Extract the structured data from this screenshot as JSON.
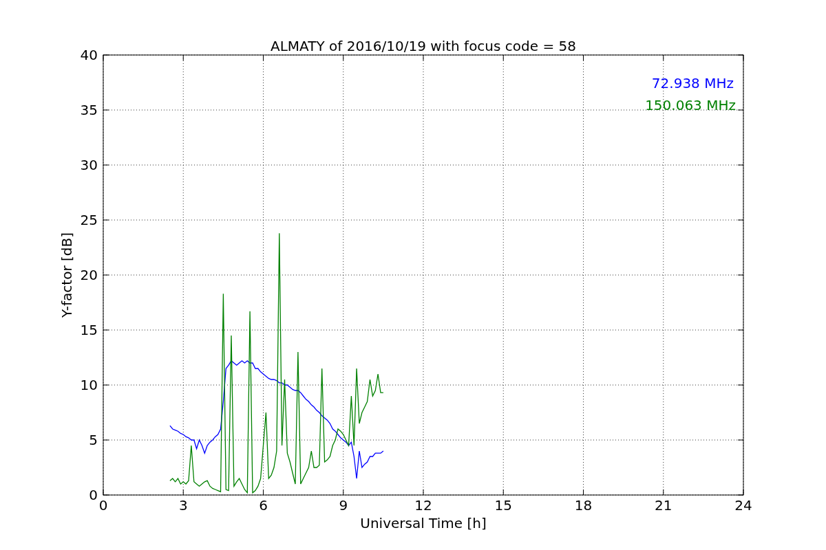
{
  "chart_data": {
    "type": "line",
    "title": "ALMATY of 2016/10/19 with focus code = 58",
    "xlabel": "Universal Time [h]",
    "ylabel": "Y-factor [dB]",
    "x": [
      2.5,
      2.6,
      2.7,
      2.8,
      2.9,
      3.0,
      3.1,
      3.2,
      3.3,
      3.4,
      3.5,
      3.6,
      3.7,
      3.8,
      3.9,
      4.0,
      4.1,
      4.2,
      4.3,
      4.4,
      4.5,
      4.6,
      4.7,
      4.8,
      4.9,
      5.0,
      5.1,
      5.2,
      5.3,
      5.4,
      5.5,
      5.6,
      5.7,
      5.8,
      5.9,
      6.0,
      6.1,
      6.2,
      6.3,
      6.4,
      6.5,
      6.6,
      6.7,
      6.8,
      6.9,
      7.0,
      7.1,
      7.2,
      7.3,
      7.4,
      7.5,
      7.6,
      7.7,
      7.8,
      7.9,
      8.0,
      8.1,
      8.2,
      8.3,
      8.4,
      8.5,
      8.6,
      8.7,
      8.8,
      8.9,
      9.0,
      9.1,
      9.2,
      9.3,
      9.4,
      9.5,
      9.6,
      9.7,
      9.8,
      9.9,
      10.0,
      10.1,
      10.2,
      10.3,
      10.4,
      10.5
    ],
    "series": [
      {
        "name": "72.938 MHz",
        "color": "#0000ff",
        "values": [
          6.3,
          6.0,
          5.9,
          5.8,
          5.6,
          5.5,
          5.3,
          5.2,
          5.0,
          5.0,
          4.2,
          5.0,
          4.5,
          3.8,
          4.5,
          4.8,
          5.0,
          5.3,
          5.5,
          6.0,
          8.5,
          11.5,
          11.8,
          12.2,
          12.0,
          11.8,
          12.0,
          12.2,
          12.0,
          12.2,
          12.0,
          12.0,
          11.5,
          11.5,
          11.2,
          11.0,
          10.8,
          10.6,
          10.5,
          10.5,
          10.4,
          10.2,
          10.2,
          10.0,
          10.0,
          9.8,
          9.6,
          9.5,
          9.5,
          9.3,
          9.0,
          8.7,
          8.5,
          8.2,
          8.0,
          7.7,
          7.5,
          7.2,
          7.0,
          6.8,
          6.5,
          6.0,
          5.8,
          5.5,
          5.2,
          5.0,
          4.8,
          4.5,
          4.8,
          3.5,
          1.5,
          4.0,
          2.5,
          2.8,
          3.0,
          3.5,
          3.5,
          3.8,
          3.8,
          3.8,
          4.0
        ]
      },
      {
        "name": "150.063 MHz",
        "color": "#008000",
        "values": [
          1.3,
          1.5,
          1.2,
          1.5,
          1.0,
          1.2,
          1.0,
          1.3,
          4.5,
          1.2,
          1.0,
          0.8,
          1.0,
          1.2,
          1.3,
          0.8,
          0.6,
          0.5,
          0.4,
          0.3,
          18.3,
          0.5,
          0.4,
          14.5,
          0.8,
          1.2,
          1.5,
          1.0,
          0.5,
          0.2,
          16.7,
          0.2,
          0.4,
          0.8,
          1.5,
          4.5,
          7.5,
          1.5,
          1.8,
          2.5,
          4.0,
          23.8,
          4.5,
          10.5,
          3.8,
          3.0,
          2.0,
          1.0,
          13.0,
          1.0,
          1.5,
          2.0,
          2.5,
          4.0,
          2.5,
          2.5,
          2.7,
          11.5,
          3.0,
          3.2,
          3.5,
          4.5,
          5.0,
          6.0,
          5.8,
          5.5,
          5.0,
          4.5,
          9.0,
          4.5,
          11.5,
          6.5,
          7.5,
          8.0,
          8.5,
          10.5,
          9.0,
          9.5,
          11.0,
          9.3,
          9.3
        ]
      }
    ],
    "grid": true,
    "xlim": [
      0,
      24
    ],
    "ylim": [
      0,
      40
    ],
    "xticks": [
      0,
      3,
      6,
      9,
      12,
      15,
      18,
      21,
      24
    ],
    "yticks": [
      0,
      5,
      10,
      15,
      20,
      25,
      30,
      35,
      40
    ]
  }
}
